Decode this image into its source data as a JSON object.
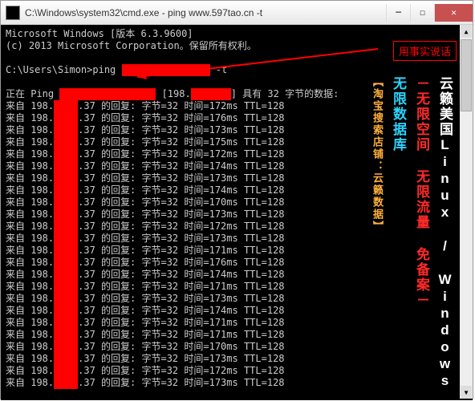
{
  "titlebar": {
    "title": "C:\\Windows\\system32\\cmd.exe - ping  www.597tao.cn -t"
  },
  "console": {
    "header1": "Microsoft Windows [版本 6.3.9600]",
    "header2": "(c) 2013 Microsoft Corporation。保留所有权利。",
    "prompt": "C:\\Users\\Simon>ping ",
    "prompt_suffix": " -t",
    "ping_prefix": "正在 Ping ",
    "ping_ip_prefix": " [198.",
    "ping_suffix": "] 具有 32 字节的数据:",
    "line_prefix": "来自 198.",
    "line_mid": ".37 的回复: 字节=32 时间=",
    "line_ttl": "ms TTL=128",
    "times": [
      "172",
      "176",
      "173",
      "175",
      "172",
      "174",
      "173",
      "174",
      "170",
      "173",
      "172",
      "173",
      "171",
      "176",
      "174",
      "171",
      "173",
      "174",
      "171",
      "171",
      "170",
      "173",
      "172",
      "173"
    ]
  },
  "callout": {
    "text": "用事实说话"
  },
  "ad": {
    "line1": "云籁美国Linux / Windows",
    "line2": "－无限空间 无限流量 免备案－",
    "line3": "无限数据库",
    "line4": "【淘宝搜索店铺：云籁数据】"
  }
}
